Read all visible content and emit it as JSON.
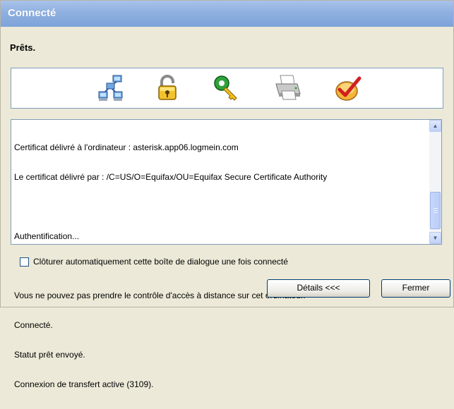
{
  "window": {
    "title": "Connecté"
  },
  "status": {
    "text": "Prêts."
  },
  "icons": [
    {
      "name": "network-icon"
    },
    {
      "name": "lock-icon"
    },
    {
      "name": "key-icon"
    },
    {
      "name": "printer-icon"
    },
    {
      "name": "checkmark-icon"
    }
  ],
  "log": {
    "lines": [
      "Certificat délivré à l'ordinateur : asterisk.app06.logmein.com",
      "Le certificat délivré par : /C=US/O=Equifax/OU=Equifax Secure Certificate Authority",
      "",
      "Authentification...",
      "",
      "Vous ne pouvez pas prendre le contrôle d'accès à distance sur cet ordinateur.",
      "Connecté.",
      "Statut prêt envoyé.",
      "Connexion de transfert active (3109)."
    ]
  },
  "options": {
    "auto_close_label": "Clôturer automatiquement cette boîte de dialogue une fois connecté",
    "auto_close_checked": false
  },
  "buttons": {
    "details": "Détails <<<",
    "close": "Fermer"
  }
}
